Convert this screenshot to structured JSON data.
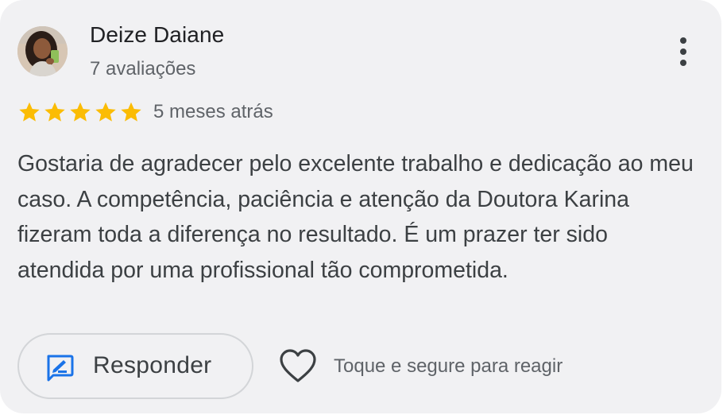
{
  "review": {
    "author_name": "Deize Daiane",
    "author_reviews": "7 avaliações",
    "rating": 5,
    "rating_max": 5,
    "time_ago": "5 meses atrás",
    "text": "Gostaria de agradecer pelo excelente trabalho e dedicação ao meu caso. A competência, paciência e atenção da Doutora Karina fizeram toda a diferença no resultado. É um prazer ter sido atendida por uma profissional tão comprometida."
  },
  "actions": {
    "reply_label": "Responder",
    "react_hint": "Toque e segure para reagir"
  },
  "icons": {
    "more": "more-vert-icon",
    "star": "star-icon",
    "reply": "reply-edit-icon",
    "heart": "heart-outline-icon"
  },
  "colors": {
    "star": "#fbbc04",
    "reply_icon": "#1a73e8",
    "card_bg": "#f1f1f3",
    "primary_text": "#202124",
    "secondary_text": "#5f6368"
  }
}
